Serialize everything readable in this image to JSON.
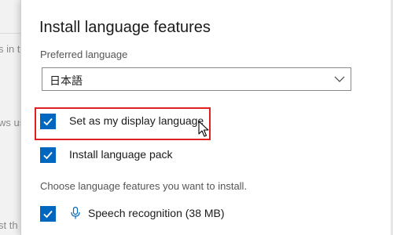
{
  "background": {
    "fragments": [
      "s in th",
      "ws us",
      "st th"
    ]
  },
  "dialog": {
    "title": "Install language features",
    "preferred_language_label": "Preferred language",
    "preferred_language_value": "日本語",
    "options": [
      {
        "label": "Set as my display language",
        "checked": true,
        "icon": "checkbox-checked-icon"
      },
      {
        "label": "Install language pack",
        "checked": true,
        "icon": "checkbox-checked-icon"
      }
    ],
    "features_prompt": "Choose language features you want to install.",
    "features": [
      {
        "label": "Speech recognition (38 MB)",
        "checked": true,
        "icon": "microphone-icon"
      }
    ]
  },
  "colors": {
    "accent": "#0067c0",
    "highlight_box": "#e02020"
  }
}
